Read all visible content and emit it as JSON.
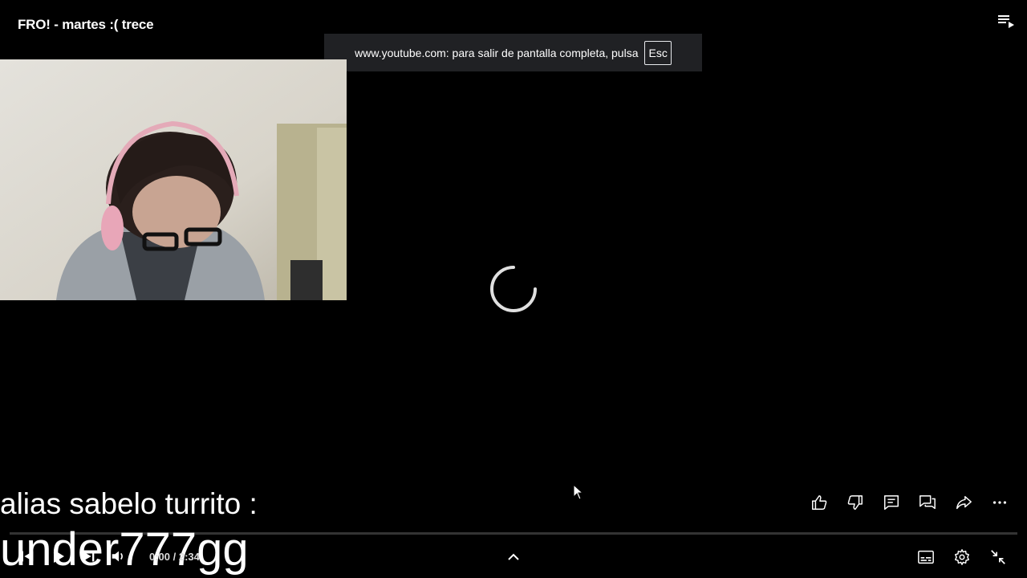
{
  "video": {
    "title": "FRO! - martes :( trece"
  },
  "fullscreen_notice": {
    "message": "www.youtube.com: para salir de pantalla completa, pulsa",
    "key": "Esc"
  },
  "overlay_text": {
    "line1": "alias sabelo turrito :",
    "line2": "under777gg"
  },
  "player": {
    "time": "0:00 / 2:34",
    "progress_fraction": 0
  },
  "icons": {
    "playlist": "playlist-icon",
    "like": "thumbs-up-icon",
    "dislike": "thumbs-down-icon",
    "comments": "comment-icon",
    "live_chat": "chat-icon",
    "share": "share-icon",
    "more": "more-icon",
    "subtitles": "subtitles-icon",
    "settings": "gear-icon",
    "exit_fullscreen": "exit-fullscreen-icon"
  },
  "colors": {
    "background": "#000000",
    "notice_bg": "#202124",
    "text": "#ffffff"
  }
}
